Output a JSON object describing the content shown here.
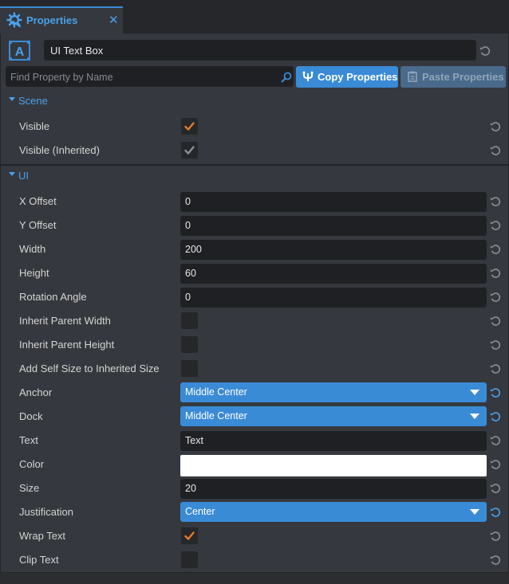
{
  "tab": {
    "label": "Properties",
    "close_glyph": "✕",
    "icon": "gear-cog-icon"
  },
  "object": {
    "icon": "ui-text-icon",
    "icon_letter": "A",
    "name": "UI Text Box"
  },
  "search": {
    "placeholder": "Find Property by Name",
    "value": ""
  },
  "buttons": {
    "copy": "Copy Properties",
    "paste": "Paste Properties"
  },
  "colors": {
    "accent": "#3a8bd6",
    "accent_text": "#4aa0ec",
    "check_orange": "#e07b2a",
    "panel": "#35383e",
    "field": "#1f2024"
  },
  "sections": [
    {
      "label": "Scene",
      "expanded": true
    },
    {
      "label": "UI",
      "expanded": true
    }
  ],
  "scene_rows": [
    {
      "label": "Visible",
      "kind": "check",
      "checked": true,
      "inherited": false
    },
    {
      "label": "Visible (Inherited)",
      "kind": "check",
      "checked": true,
      "inherited": true
    }
  ],
  "ui_rows": [
    {
      "label": "X Offset",
      "kind": "text",
      "value": "0"
    },
    {
      "label": "Y Offset",
      "kind": "text",
      "value": "0"
    },
    {
      "label": "Width",
      "kind": "text",
      "value": "200"
    },
    {
      "label": "Height",
      "kind": "text",
      "value": "60"
    },
    {
      "label": "Rotation Angle",
      "kind": "text",
      "value": "0"
    },
    {
      "label": "Inherit Parent Width",
      "kind": "check",
      "checked": false
    },
    {
      "label": "Inherit Parent Height",
      "kind": "check",
      "checked": false
    },
    {
      "label": "Add Self Size to Inherited Size",
      "kind": "check",
      "checked": false
    },
    {
      "label": "Anchor",
      "kind": "dropdown",
      "value": "Middle Center",
      "modified": true
    },
    {
      "label": "Dock",
      "kind": "dropdown",
      "value": "Middle Center",
      "modified": true
    },
    {
      "label": "Text",
      "kind": "text",
      "value": "Text"
    },
    {
      "label": "Color",
      "kind": "color",
      "value": "#ffffff"
    },
    {
      "label": "Size",
      "kind": "text",
      "value": "20"
    },
    {
      "label": "Justification",
      "kind": "dropdown",
      "value": "Center",
      "modified": true
    },
    {
      "label": "Wrap Text",
      "kind": "check",
      "checked": true
    },
    {
      "label": "Clip Text",
      "kind": "check",
      "checked": false
    }
  ]
}
